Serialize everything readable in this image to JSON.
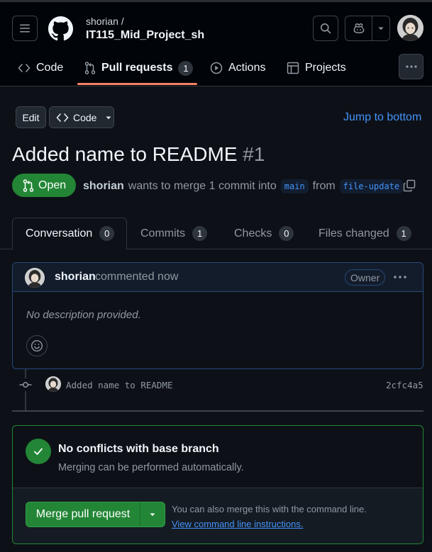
{
  "header": {
    "owner": "shorian /",
    "repo": "IT115_Mid_Project_sh"
  },
  "nav": {
    "code": "Code",
    "pull_requests": "Pull requests",
    "pull_requests_count": "1",
    "actions": "Actions",
    "projects": "Projects"
  },
  "toolbar": {
    "edit": "Edit",
    "code": "Code",
    "jump": "Jump to bottom"
  },
  "pr": {
    "title": "Added name to README",
    "number": "#1",
    "state": "Open",
    "author": "shorian",
    "merge_text": "wants to merge 1 commit into",
    "base": "main",
    "from": "from",
    "head": "file-update"
  },
  "tabs": [
    {
      "label": "Conversation",
      "count": "0"
    },
    {
      "label": "Commits",
      "count": "1"
    },
    {
      "label": "Checks",
      "count": "0"
    },
    {
      "label": "Files changed",
      "count": "1"
    }
  ],
  "comment": {
    "author": "shorian",
    "when": "commented now",
    "role": "Owner",
    "body": "No description provided."
  },
  "commit": {
    "message": "Added name to README",
    "sha": "2cfc4a5"
  },
  "merge": {
    "title": "No conflicts with base branch",
    "subtitle": "Merging can be performed automatically.",
    "button": "Merge pull request",
    "hint": "You can also merge this with the command line.",
    "link": "View command line instructions."
  },
  "colors": {
    "accent_link": "#4493f8",
    "open_green": "#238636",
    "tab_underline": "#f78166"
  }
}
